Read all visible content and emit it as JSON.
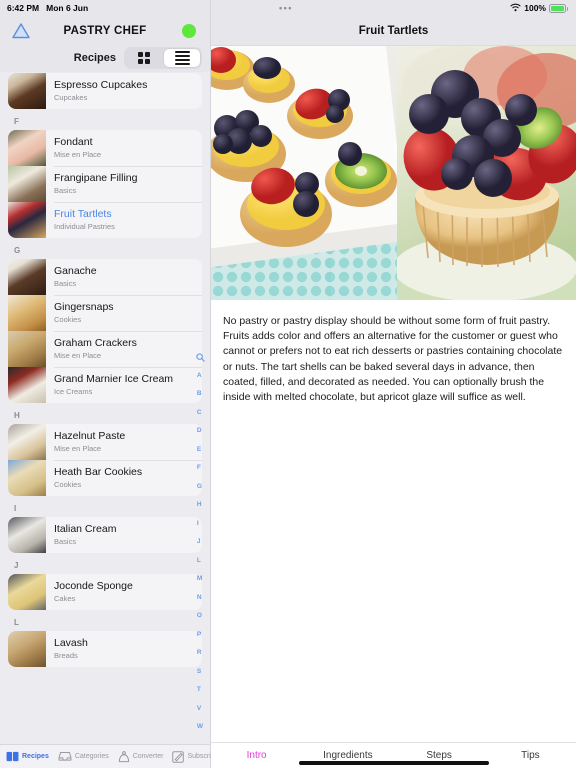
{
  "status_bar": {
    "time": "6:42 PM",
    "date": "Mon 6 Jun",
    "battery_percent": "100%",
    "wifi_icon": "wifi-icon",
    "battery_icon": "battery-charging-icon"
  },
  "left": {
    "logo_icon": "triangle-logo-icon",
    "app_title": "PASTRY CHEF",
    "status_dot_color": "#5ee83c",
    "toolbar": {
      "label": "Recipes",
      "grid_view_icon": "grid-view-icon",
      "list_view_icon": "list-view-icon",
      "selected_view": "list"
    },
    "sections": [
      {
        "letter": "",
        "items": [
          {
            "title": "Espresso Cupcakes",
            "subtitle": "Cupcakes",
            "selected": false,
            "thumb": "espresso-cupcake-photo"
          }
        ]
      },
      {
        "letter": "F",
        "items": [
          {
            "title": "Fondant",
            "subtitle": "Mise en Place",
            "selected": false,
            "thumb": "fondant-photo"
          },
          {
            "title": "Frangipane Filling",
            "subtitle": "Basics",
            "selected": false,
            "thumb": "frangipane-photo"
          },
          {
            "title": "Fruit Tartlets",
            "subtitle": "Individual Pastries",
            "selected": true,
            "thumb": "fruit-tartlet-photo"
          }
        ]
      },
      {
        "letter": "G",
        "items": [
          {
            "title": "Ganache",
            "subtitle": "Basics",
            "selected": false,
            "thumb": "ganache-photo"
          },
          {
            "title": "Gingersnaps",
            "subtitle": "Cookies",
            "selected": false,
            "thumb": "gingersnaps-photo"
          },
          {
            "title": "Graham Crackers",
            "subtitle": "Mise en Place",
            "selected": false,
            "thumb": "graham-crackers-photo"
          },
          {
            "title": "Grand Marnier Ice Cream",
            "subtitle": "Ice Creams",
            "selected": false,
            "thumb": "grand-marnier-photo"
          }
        ]
      },
      {
        "letter": "H",
        "items": [
          {
            "title": "Hazelnut Paste",
            "subtitle": "Mise en Place",
            "selected": false,
            "thumb": "hazelnut-paste-photo"
          },
          {
            "title": "Heath Bar Cookies",
            "subtitle": "Cookies",
            "selected": false,
            "thumb": "heath-bar-photo"
          }
        ]
      },
      {
        "letter": "I",
        "items": [
          {
            "title": "Italian Cream",
            "subtitle": "Basics",
            "selected": false,
            "thumb": "italian-cream-photo"
          }
        ]
      },
      {
        "letter": "J",
        "items": [
          {
            "title": "Joconde Sponge",
            "subtitle": "Cakes",
            "selected": false,
            "thumb": "joconde-sponge-photo"
          }
        ]
      },
      {
        "letter": "L",
        "items": [
          {
            "title": "Lavash",
            "subtitle": "Breads",
            "selected": false,
            "thumb": "lavash-photo"
          }
        ]
      }
    ],
    "alpha_index": {
      "search_icon": "search-icon",
      "letters": [
        "A",
        "B",
        "C",
        "D",
        "E",
        "F",
        "G",
        "H",
        "I",
        "J",
        "L",
        "M",
        "N",
        "O",
        "P",
        "R",
        "S",
        "T",
        "V",
        "W"
      ],
      "color": "#6d9eeb"
    },
    "tabbar": {
      "items": [
        {
          "label": "Recipes",
          "icon": "book-icon",
          "active": true
        },
        {
          "label": "Categories",
          "icon": "tray-icon",
          "active": false
        },
        {
          "label": "Converter",
          "icon": "scale-icon",
          "active": false
        },
        {
          "label": "Subscription",
          "icon": "compose-icon",
          "active": false
        }
      ]
    }
  },
  "right": {
    "window_dots_icon": "window-menu-dots-icon",
    "title": "Fruit Tartlets",
    "photos": [
      {
        "name": "fruit-tartlets-tray-photo"
      },
      {
        "name": "fruit-tartlet-closeup-photo"
      }
    ],
    "intro_text": "No pastry or pastry display should be without some form of fruit pastry. Fruits adds color and offers an alternative for the customer or guest who cannot or prefers not to eat rich desserts or pastries  containing chocolate or nuts. The tart shells can be baked several days in advance, then coated, filled, and decorated as needed. You can optionally brush the inside with melted chocolate, but apricot glaze will suffice as well.",
    "tabbar": {
      "accent_color": "#e83ad8",
      "items": [
        {
          "label": "Intro",
          "active": true
        },
        {
          "label": "Ingredients",
          "active": false
        },
        {
          "label": "Steps",
          "active": false
        },
        {
          "label": "Tips",
          "active": false
        }
      ]
    }
  }
}
